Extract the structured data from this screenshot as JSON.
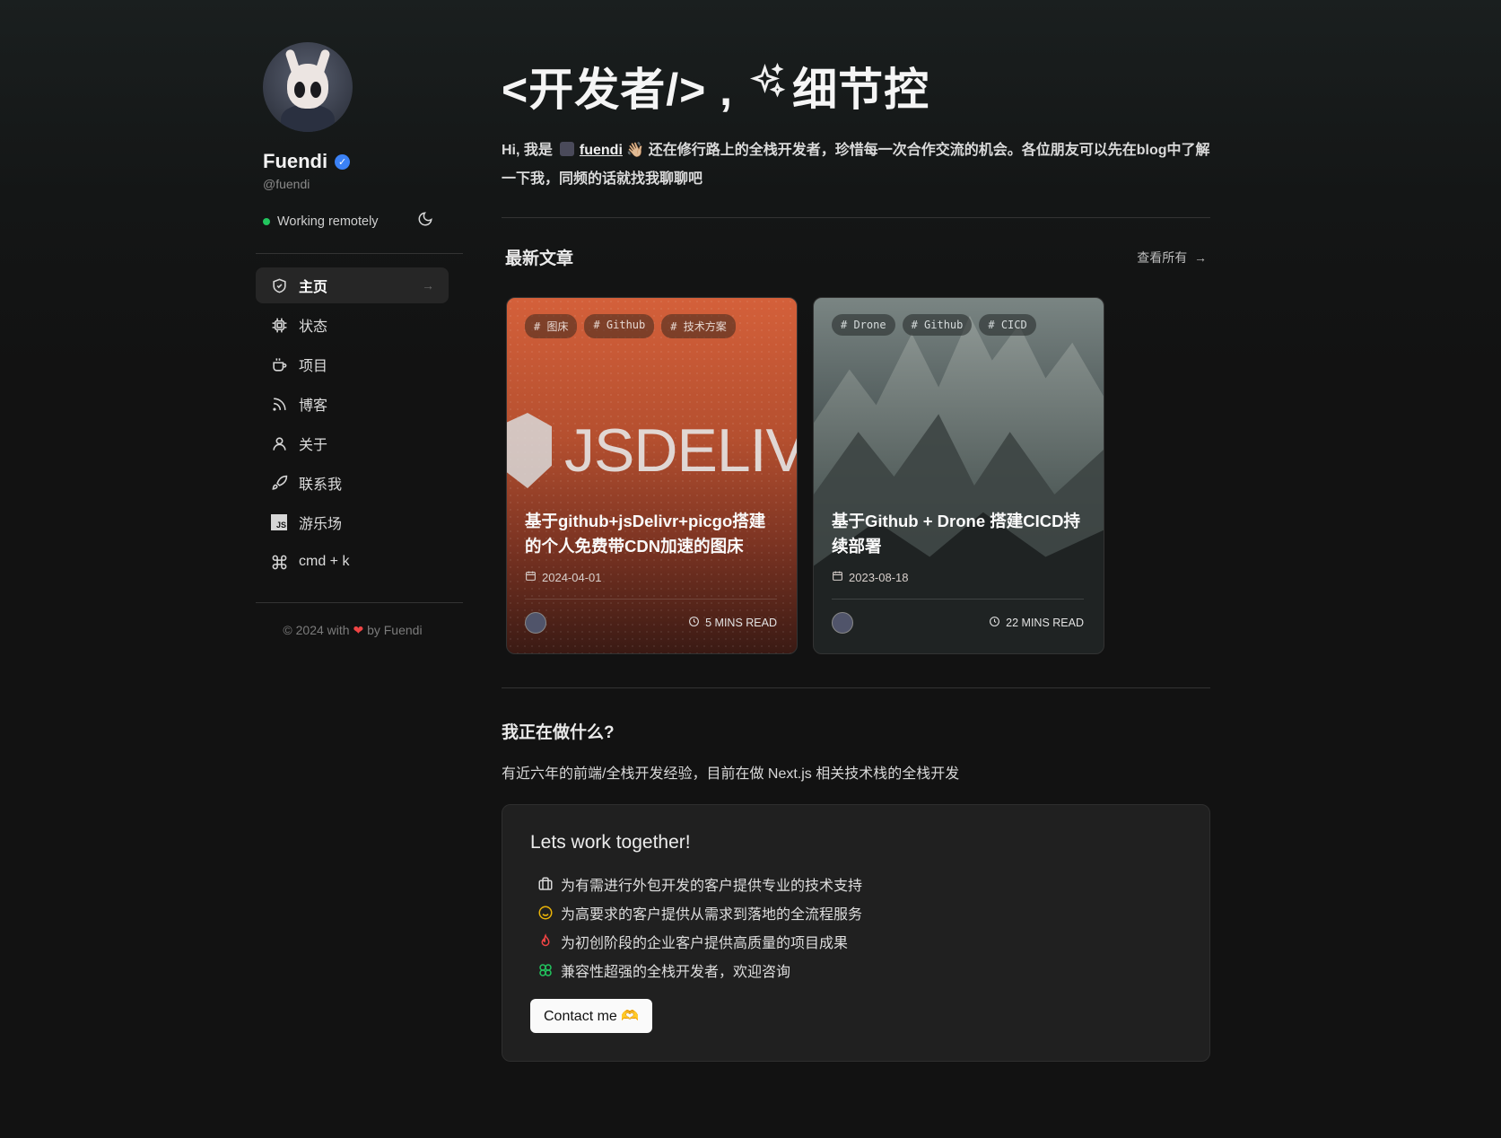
{
  "profile": {
    "name": "Fuendi",
    "handle": "@fuendi",
    "status": "Working remotely"
  },
  "nav": [
    {
      "label": "主页",
      "icon": "shield-check-icon"
    },
    {
      "label": "状态",
      "icon": "cpu-icon"
    },
    {
      "label": "项目",
      "icon": "coffee-cup-icon"
    },
    {
      "label": "博客",
      "icon": "rss-icon"
    },
    {
      "label": "关于",
      "icon": "user-icon"
    },
    {
      "label": "联系我",
      "icon": "rocket-icon"
    },
    {
      "label": "游乐场",
      "icon": "js-icon"
    },
    {
      "label": "cmd + k",
      "icon": "command-icon"
    }
  ],
  "footer": {
    "prefix": "© 2024 with",
    "suffix": "by Fuendi"
  },
  "hero": {
    "title_a": "<开发者/> ,",
    "title_b": "细节控",
    "intro_a": "Hi, 我是",
    "intro_link": "fuendi",
    "intro_b": "还在修行路上的全栈开发者，珍惜每一次合作交流的机会。各位朋友可以先在blog中了解一下我，同频的话就找我聊聊吧"
  },
  "posts_section": {
    "title": "最新文章",
    "view_all": "查看所有"
  },
  "posts": [
    {
      "tags": [
        "# 图床",
        "# Github",
        "# 技术方案"
      ],
      "brand": "JSDELIVR",
      "title": "基于github+jsDelivr+picgo搭建的个人免费带CDN加速的图床",
      "date": "2024-04-01",
      "read": "5 MINS READ"
    },
    {
      "tags": [
        "# Drone",
        "# Github",
        "# CICD"
      ],
      "title": "基于Github + Drone 搭建CICD持续部署",
      "date": "2023-08-18",
      "read": "22 MINS READ"
    }
  ],
  "doing": {
    "title": "我正在做什么?",
    "desc": "有近六年的前端/全栈开发经验，目前在做 Next.js 相关技术栈的全栈开发"
  },
  "work": {
    "title": "Lets work together!",
    "items": [
      {
        "text": "为有需进行外包开发的客户提供专业的技术支持",
        "icon": "briefcase-icon",
        "color": "#d8d8d8"
      },
      {
        "text": "为高要求的客户提供从需求到落地的全流程服务",
        "icon": "smile-icon",
        "color": "#eab308"
      },
      {
        "text": "为初创阶段的企业客户提供高质量的项目成果",
        "icon": "flame-icon",
        "color": "#ef4444"
      },
      {
        "text": "兼容性超强的全栈开发者，欢迎咨询",
        "icon": "clover-icon",
        "color": "#22c55e"
      }
    ],
    "button": "Contact me 🫶"
  }
}
